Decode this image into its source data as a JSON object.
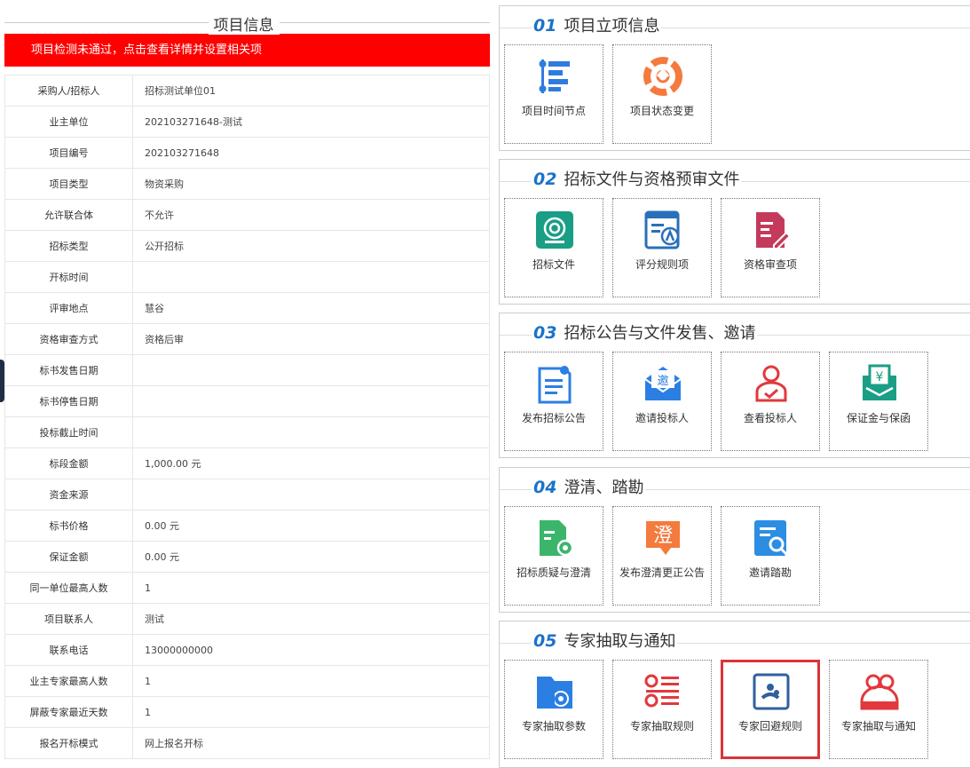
{
  "left": {
    "title": "项目信息",
    "alert": "项目检测未通过，点击查看详情并设置相关项",
    "rows": [
      {
        "k": "采购人/招标人",
        "v": "招标测试单位01"
      },
      {
        "k": "业主单位",
        "v": "202103271648-测试"
      },
      {
        "k": "项目编号",
        "v": "202103271648"
      },
      {
        "k": "项目类型",
        "v": "物资采购"
      },
      {
        "k": "允许联合体",
        "v": "不允许"
      },
      {
        "k": "招标类型",
        "v": "公开招标"
      },
      {
        "k": "开标时间",
        "v": ""
      },
      {
        "k": "评审地点",
        "v": "慧谷"
      },
      {
        "k": "资格审查方式",
        "v": "资格后审"
      },
      {
        "k": "标书发售日期",
        "v": ""
      },
      {
        "k": "标书停售日期",
        "v": ""
      },
      {
        "k": "投标截止时间",
        "v": ""
      },
      {
        "k": "标段金额",
        "v": "1,000.00 元"
      },
      {
        "k": "资金来源",
        "v": ""
      },
      {
        "k": "标书价格",
        "v": "0.00 元"
      },
      {
        "k": "保证金额",
        "v": "0.00 元"
      },
      {
        "k": "同一单位最高人数",
        "v": "1"
      },
      {
        "k": "项目联系人",
        "v": "测试"
      },
      {
        "k": "联系电话",
        "v": "13000000000"
      },
      {
        "k": "业主专家最高人数",
        "v": "1"
      },
      {
        "k": "屏蔽专家最近天数",
        "v": "1"
      },
      {
        "k": "报名开标模式",
        "v": "网上报名开标"
      }
    ]
  },
  "sections": [
    {
      "num": "01",
      "title": "项目立项信息",
      "cards": [
        {
          "label": "项目时间节点",
          "icon": "timeline-icon",
          "color": "#2f7ce0"
        },
        {
          "label": "项目状态变更",
          "icon": "status-change-icon",
          "color": "#f47a3d"
        }
      ]
    },
    {
      "num": "02",
      "title": "招标文件与资格预审文件",
      "cards": [
        {
          "label": "招标文件",
          "icon": "target-file-icon",
          "color": "#1a9e85"
        },
        {
          "label": "评分规则项",
          "icon": "scoring-rule-icon",
          "color": "#2a6fb9"
        },
        {
          "label": "资格审查项",
          "icon": "qualification-review-icon",
          "color": "#c43a5c"
        }
      ]
    },
    {
      "num": "03",
      "title": "招标公告与文件发售、邀请",
      "cards": [
        {
          "label": "发布招标公告",
          "icon": "publish-notice-icon",
          "color": "#2b7fe3"
        },
        {
          "label": "邀请投标人",
          "icon": "invite-mail-icon",
          "color": "#2b7fe3"
        },
        {
          "label": "查看投标人",
          "icon": "bidder-person-icon",
          "color": "#e2383d"
        },
        {
          "label": "保证金与保函",
          "icon": "deposit-icon",
          "color": "#1a9e85"
        }
      ]
    },
    {
      "num": "04",
      "title": "澄清、踏勘",
      "cards": [
        {
          "label": "招标质疑与澄清",
          "icon": "doc-gear-icon",
          "color": "#3bb56a"
        },
        {
          "label": "发布澄清更正公告",
          "icon": "clarify-badge-icon",
          "color": "#f47a3d"
        },
        {
          "label": "邀请踏勘",
          "icon": "search-doc-icon",
          "color": "#2b8ee3"
        }
      ]
    },
    {
      "num": "05",
      "title": "专家抽取与通知",
      "cards": [
        {
          "label": "专家抽取参数",
          "icon": "folder-gear-icon",
          "color": "#2b7fe3"
        },
        {
          "label": "专家抽取规则",
          "icon": "list-rules-icon",
          "color": "#e2383d"
        },
        {
          "label": "专家回避规则",
          "icon": "avoid-rule-icon",
          "color": "#2f5f9e",
          "selected": true
        },
        {
          "label": "专家抽取与通知",
          "icon": "experts-group-icon",
          "color": "#e2383d"
        }
      ]
    }
  ]
}
